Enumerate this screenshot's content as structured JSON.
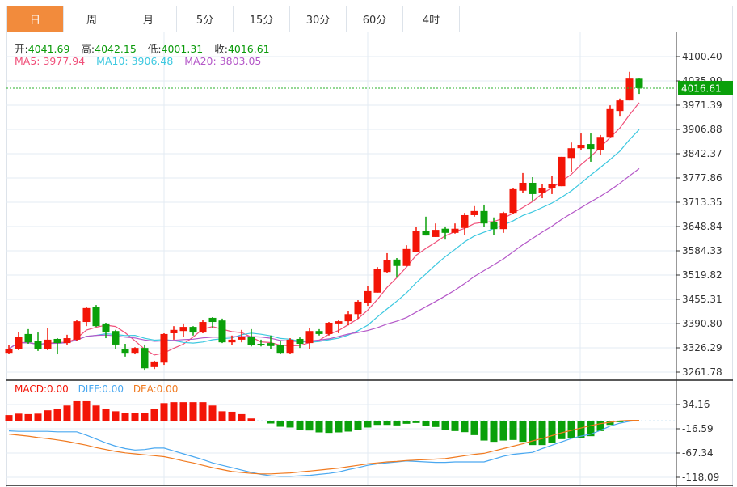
{
  "tabs": [
    {
      "label": "日",
      "active": true
    },
    {
      "label": "周"
    },
    {
      "label": "月"
    },
    {
      "label": "5分"
    },
    {
      "label": "15分"
    },
    {
      "label": "30分"
    },
    {
      "label": "60分"
    },
    {
      "label": "4时"
    }
  ],
  "info": {
    "open_label": "开:",
    "open": "4041.69",
    "high_label": "高:",
    "high": "4042.15",
    "low_label": "低:",
    "low": "4001.31",
    "close_label": "收:",
    "close": "4016.61"
  },
  "ma": {
    "ma5": "MA5: 3977.94",
    "ma10": "MA10: 3906.48",
    "ma20": "MA20: 3803.05"
  },
  "macd_info": {
    "macd": "MACD:0.00",
    "diff": "DIFF:0.00",
    "dea": "DEA:0.00"
  },
  "colors": {
    "up": "#f31507",
    "down": "#0aa00a",
    "ma5": "#f0507a",
    "ma10": "#3cc8e0",
    "ma20": "#b457c8",
    "diff": "#4aa8f0",
    "dea": "#f07a20",
    "active_tab": "#f28b3c"
  },
  "chart_data": {
    "type": "candlestick",
    "price_axis": {
      "ticks": [
        "4100.40",
        "4035.90",
        "3971.39",
        "3906.88",
        "3842.37",
        "3777.86",
        "3713.35",
        "3648.84",
        "3584.33",
        "3519.82",
        "3455.31",
        "3390.80",
        "3326.29",
        "3261.78"
      ],
      "range": [
        3261.78,
        4100.4
      ]
    },
    "last_price": "4016.61",
    "ohlc": [
      [
        3313,
        3333,
        3311,
        3324
      ],
      [
        3322,
        3369,
        3320,
        3356
      ],
      [
        3363,
        3376,
        3337,
        3341
      ],
      [
        3344,
        3367,
        3318,
        3322
      ],
      [
        3322,
        3378,
        3320,
        3348
      ],
      [
        3350,
        3352,
        3309,
        3339
      ],
      [
        3339,
        3361,
        3335,
        3352
      ],
      [
        3348,
        3401,
        3344,
        3397
      ],
      [
        3395,
        3434,
        3384,
        3432
      ],
      [
        3434,
        3440,
        3382,
        3384
      ],
      [
        3391,
        3393,
        3352,
        3367
      ],
      [
        3371,
        3374,
        3324,
        3335
      ],
      [
        3322,
        3337,
        3303,
        3313
      ],
      [
        3313,
        3328,
        3309,
        3326
      ],
      [
        3326,
        3335,
        3268,
        3272
      ],
      [
        3275,
        3292,
        3270,
        3290
      ],
      [
        3287,
        3365,
        3281,
        3363
      ],
      [
        3365,
        3384,
        3348,
        3374
      ],
      [
        3371,
        3391,
        3356,
        3382
      ],
      [
        3382,
        3384,
        3359,
        3367
      ],
      [
        3367,
        3401,
        3365,
        3395
      ],
      [
        3406,
        3408,
        3378,
        3395
      ],
      [
        3399,
        3404,
        3339,
        3341
      ],
      [
        3341,
        3359,
        3333,
        3348
      ],
      [
        3348,
        3374,
        3341,
        3356
      ],
      [
        3356,
        3376,
        3330,
        3333
      ],
      [
        3337,
        3348,
        3330,
        3333
      ],
      [
        3339,
        3359,
        3324,
        3331
      ],
      [
        3333,
        3346,
        3311,
        3313
      ],
      [
        3313,
        3352,
        3311,
        3348
      ],
      [
        3350,
        3354,
        3326,
        3337
      ],
      [
        3339,
        3380,
        3322,
        3371
      ],
      [
        3371,
        3376,
        3359,
        3363
      ],
      [
        3363,
        3395,
        3359,
        3393
      ],
      [
        3391,
        3401,
        3365,
        3397
      ],
      [
        3397,
        3423,
        3386,
        3416
      ],
      [
        3416,
        3453,
        3404,
        3449
      ],
      [
        3445,
        3490,
        3438,
        3477
      ],
      [
        3473,
        3541,
        3473,
        3535
      ],
      [
        3528,
        3578,
        3526,
        3559
      ],
      [
        3561,
        3565,
        3513,
        3544
      ],
      [
        3544,
        3599,
        3544,
        3589
      ],
      [
        3580,
        3647,
        3580,
        3636
      ],
      [
        3636,
        3675,
        3625,
        3625
      ],
      [
        3621,
        3657,
        3621,
        3640
      ],
      [
        3643,
        3649,
        3614,
        3632
      ],
      [
        3632,
        3657,
        3630,
        3643
      ],
      [
        3645,
        3685,
        3627,
        3679
      ],
      [
        3679,
        3703,
        3675,
        3690
      ],
      [
        3690,
        3707,
        3647,
        3657
      ],
      [
        3660,
        3673,
        3627,
        3642
      ],
      [
        3642,
        3688,
        3632,
        3685
      ],
      [
        3685,
        3750,
        3683,
        3748
      ],
      [
        3744,
        3791,
        3737,
        3765
      ],
      [
        3765,
        3780,
        3718,
        3735
      ],
      [
        3737,
        3761,
        3724,
        3750
      ],
      [
        3750,
        3784,
        3735,
        3761
      ],
      [
        3756,
        3834,
        3756,
        3834
      ],
      [
        3831,
        3872,
        3793,
        3857
      ],
      [
        3857,
        3896,
        3853,
        3866
      ],
      [
        3868,
        3896,
        3821,
        3855
      ],
      [
        3853,
        3892,
        3838,
        3887
      ],
      [
        3887,
        3971,
        3887,
        3961
      ],
      [
        3956,
        3989,
        3941,
        3984
      ],
      [
        3984,
        4060,
        3984,
        4042
      ],
      [
        4041.69,
        4042.15,
        4001.31,
        4016.61
      ]
    ],
    "macd_axis": {
      "ticks": [
        "34.16",
        "-16.59",
        "-67.34",
        "-118.09"
      ],
      "range": [
        -118.09,
        34.16
      ]
    },
    "macd_hist": [
      12,
      15,
      14,
      15,
      22,
      25,
      32,
      41,
      41,
      32,
      25,
      20,
      17,
      17,
      17,
      25,
      37,
      39,
      39,
      39,
      39,
      32,
      20,
      19,
      14,
      5,
      0,
      -5.6,
      -12.4,
      -14,
      -18.6,
      -20.3,
      -24.2,
      -25.3,
      -24.2,
      -22.5,
      -18.6,
      -14,
      -8.5,
      -8.5,
      -9.6,
      -6.2,
      -4.5,
      -10.1,
      -12.9,
      -18.6,
      -21.4,
      -23.7,
      -29.9,
      -41.2,
      -43.9,
      -41.2,
      -40,
      -43.9,
      -50.7,
      -50.7,
      -46.2,
      -38.3,
      -35.5,
      -35.5,
      -32.1,
      -21.4,
      -8.5,
      -2.8,
      0,
      0
    ],
    "diff": [
      -21,
      -22,
      -22,
      -22,
      -22,
      -23,
      -23,
      -23,
      -30,
      -38,
      -46,
      -53,
      -58,
      -61,
      -60,
      -57,
      -57,
      -63,
      -69,
      -75,
      -81,
      -88,
      -93,
      -98,
      -103,
      -108,
      -112,
      -115,
      -116,
      -116,
      -115,
      -114,
      -112,
      -110,
      -107,
      -102,
      -98,
      -93,
      -90,
      -88,
      -86,
      -84,
      -85,
      -86,
      -87,
      -87,
      -86,
      -86,
      -86,
      -86,
      -80,
      -74,
      -70,
      -68,
      -66,
      -58,
      -51,
      -44,
      -37,
      -32,
      -28,
      -20,
      -11,
      -5,
      -1,
      1
    ],
    "dea": [
      -28,
      -30,
      -32,
      -35,
      -37,
      -40,
      -43,
      -47,
      -51,
      -56,
      -60,
      -64,
      -67,
      -69,
      -71,
      -73,
      -75,
      -79,
      -84,
      -88,
      -93,
      -98,
      -102,
      -106,
      -108,
      -110,
      -111,
      -111,
      -110,
      -109,
      -107,
      -105,
      -103,
      -101,
      -99,
      -96,
      -93,
      -90,
      -88,
      -86,
      -85,
      -83,
      -82,
      -81,
      -80,
      -79,
      -76,
      -73,
      -70,
      -68,
      -63,
      -58,
      -53,
      -48,
      -42,
      -37,
      -31,
      -25,
      -20,
      -15,
      -10,
      -6,
      -3,
      0,
      1,
      1
    ]
  }
}
